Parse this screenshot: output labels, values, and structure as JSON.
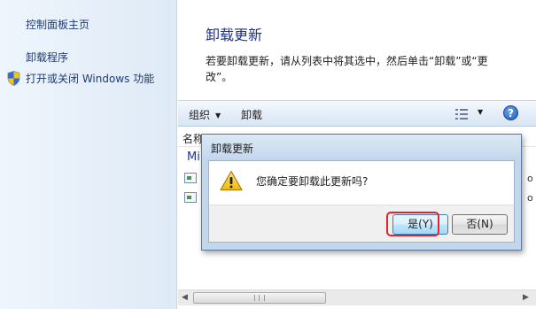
{
  "sidebar": {
    "home_link": "控制面板主页",
    "programs_link": "卸载程序",
    "features_link": "打开或关闭 Windows 功能",
    "shield_icon": "uac-shield-icon"
  },
  "main": {
    "title": "卸载更新",
    "instruction": "若要卸载更新，请从列表中将其选中，然后单击“卸载”或“更改”。"
  },
  "toolbar": {
    "organize_label": "组织",
    "organize_caret": "▼",
    "uninstall_label": "卸载",
    "views_caret": "▼",
    "help_label": "?"
  },
  "list": {
    "column_name": "名称",
    "group_label": "Mi",
    "row_trailing_glyph": "o"
  },
  "scrollbar": {
    "left_arrow": "◀",
    "right_arrow": "▶"
  },
  "dialog": {
    "title": "卸载更新",
    "message": "您确定要卸载此更新吗?",
    "yes_label": "是(Y)",
    "no_label": "否(N)"
  },
  "colors": {
    "sidebar_link": "#1d3b72",
    "title": "#1e3287",
    "highlight": "#e0242a"
  }
}
